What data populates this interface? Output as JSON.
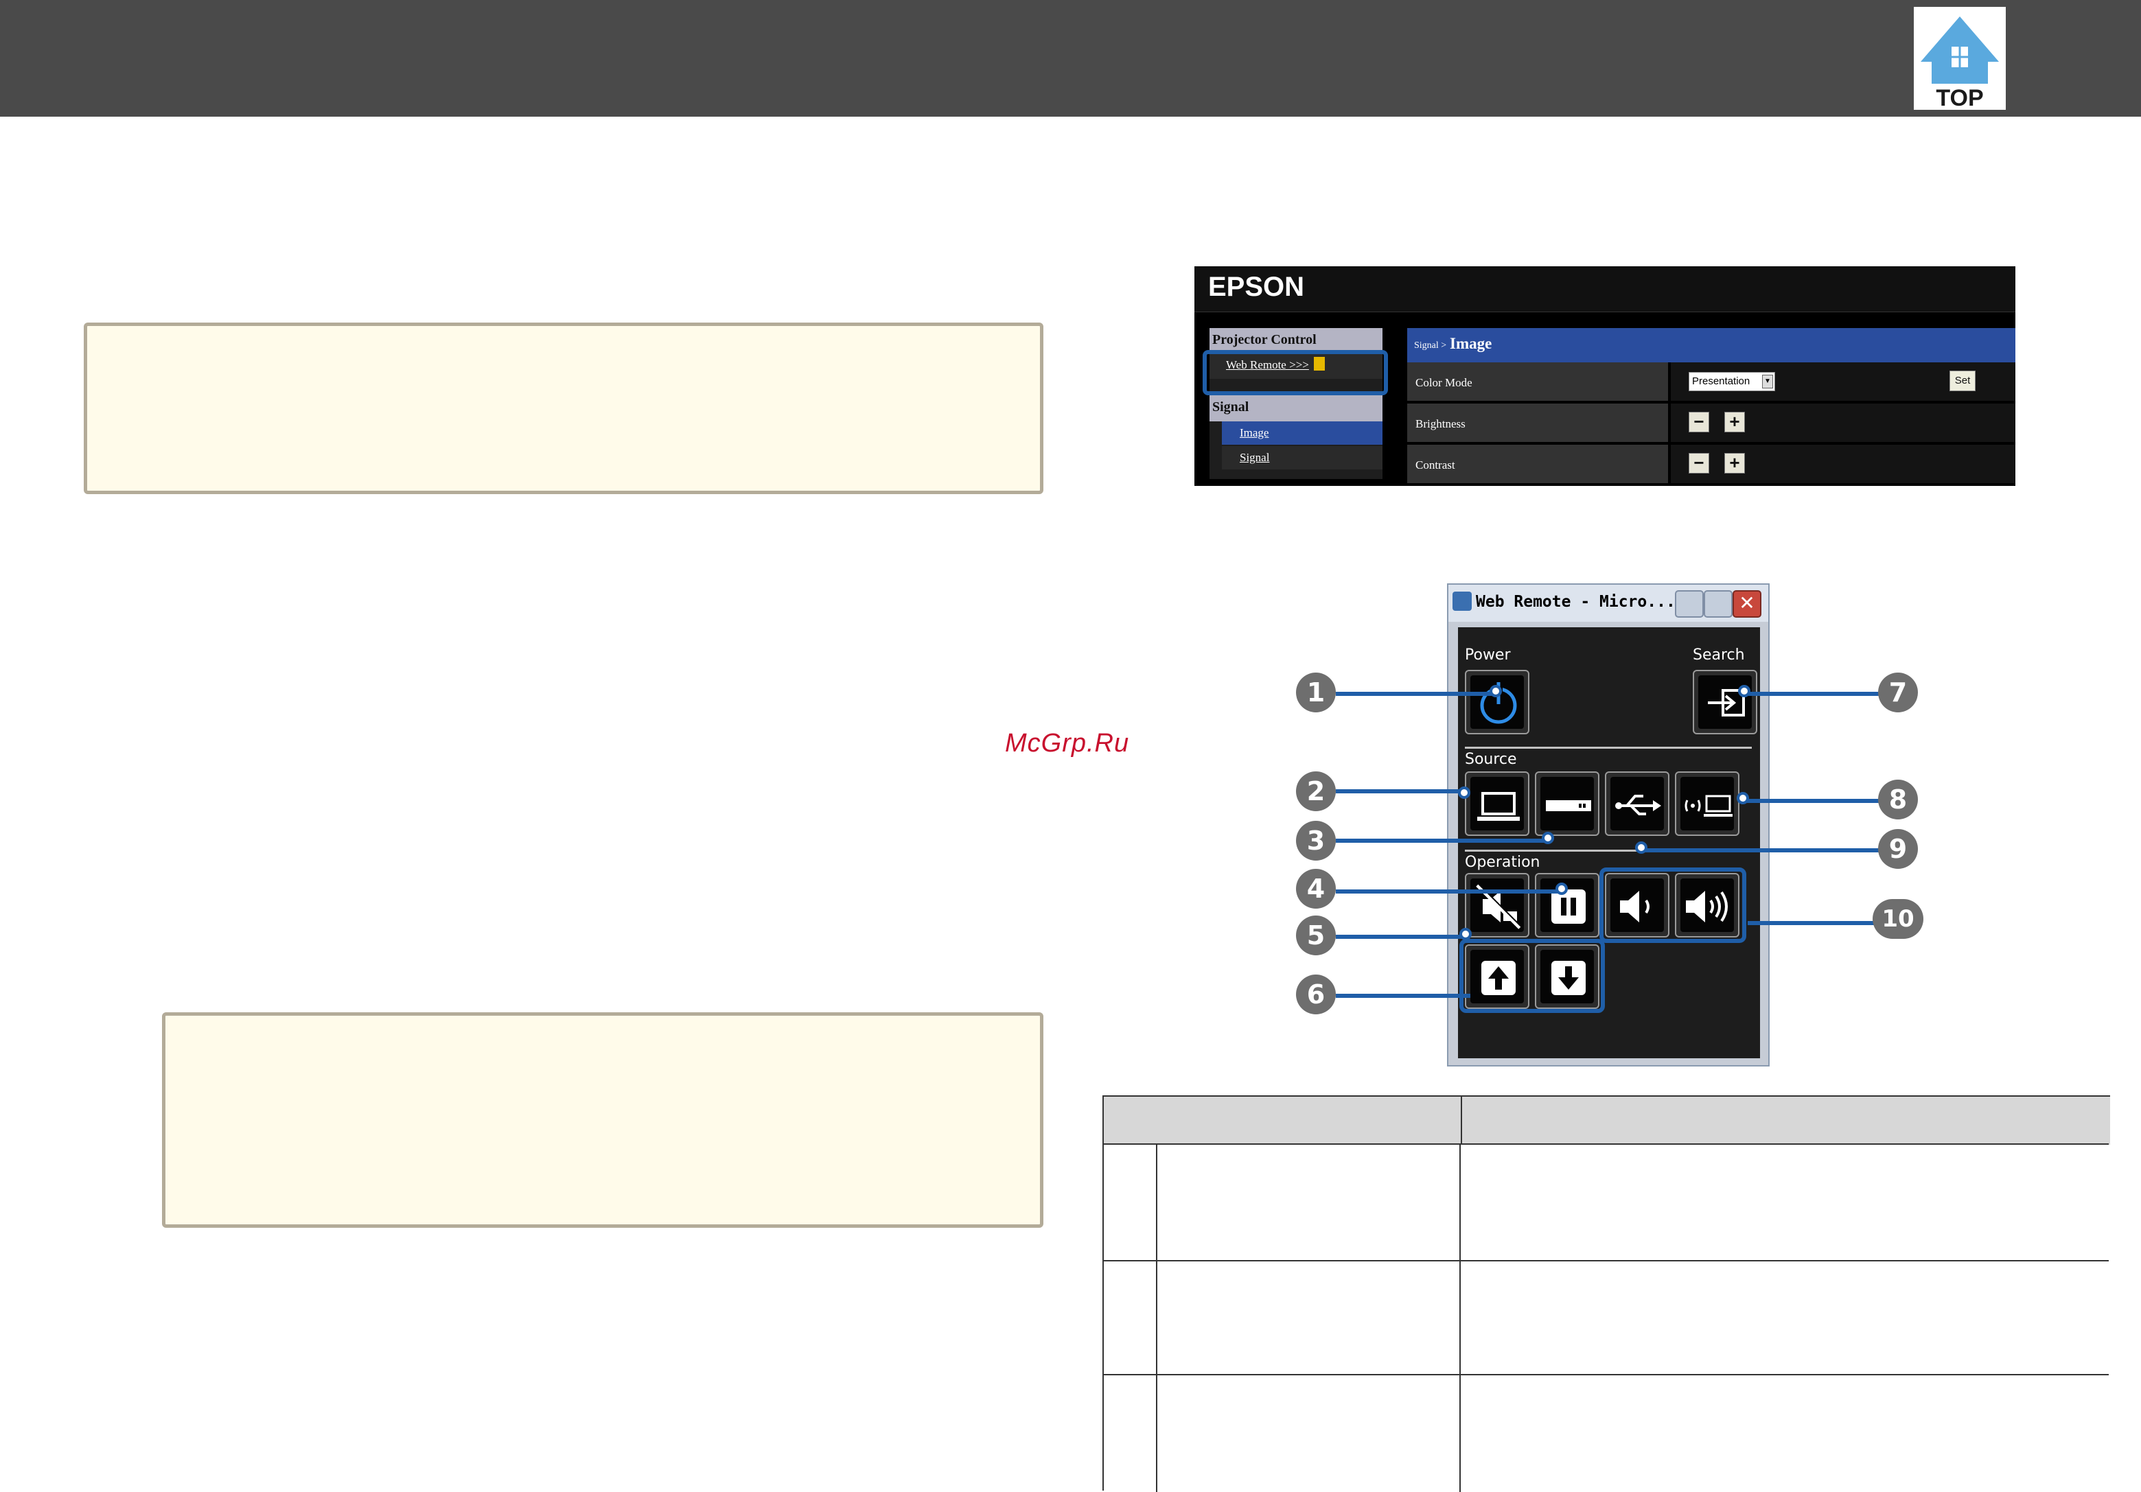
{
  "header": {
    "logo_text": "TOP",
    "bar_color": "#4a4a4a"
  },
  "watermark": {
    "text": "McGrp.Ru",
    "color": "#c8102e"
  },
  "notes": [
    {
      "text": ""
    },
    {
      "text": ""
    }
  ],
  "epson_page": {
    "logo": "EPSON",
    "sidebar": {
      "projector_control": "Projector Control",
      "web_remote": "Web Remote >>>",
      "signal_heading": "Signal",
      "items": [
        "Image",
        "Signal"
      ]
    },
    "breadcrumb": {
      "parent": "Signal >",
      "current": "Image"
    },
    "rows": [
      {
        "label": "Color Mode",
        "select_value": "Presentation",
        "button": "Set"
      },
      {
        "label": "Brightness",
        "minus": "−",
        "plus": "+"
      },
      {
        "label": "Contrast",
        "minus": "−",
        "plus": "+"
      }
    ],
    "accent": "#2a4d9e"
  },
  "web_remote": {
    "title": "Web Remote - Micro...",
    "labels": {
      "power": "Power",
      "search": "Search",
      "source": "Source",
      "operation": "Operation"
    },
    "callouts": [
      "1",
      "2",
      "3",
      "4",
      "5",
      "6",
      "7",
      "8",
      "9",
      "10"
    ],
    "icons": [
      "power-icon",
      "search-icon",
      "computer-icon",
      "video-icon",
      "usb-icon",
      "network-icon",
      "av-mute-icon",
      "freeze-icon",
      "volume-down-icon",
      "volume-up-icon",
      "page-up-icon",
      "page-down-icon"
    ],
    "accent": "#1f5ea8"
  },
  "table": {
    "header": [
      "",
      ""
    ],
    "rows": [
      [
        "",
        ""
      ],
      [
        "",
        ""
      ],
      [
        "",
        ""
      ]
    ]
  }
}
